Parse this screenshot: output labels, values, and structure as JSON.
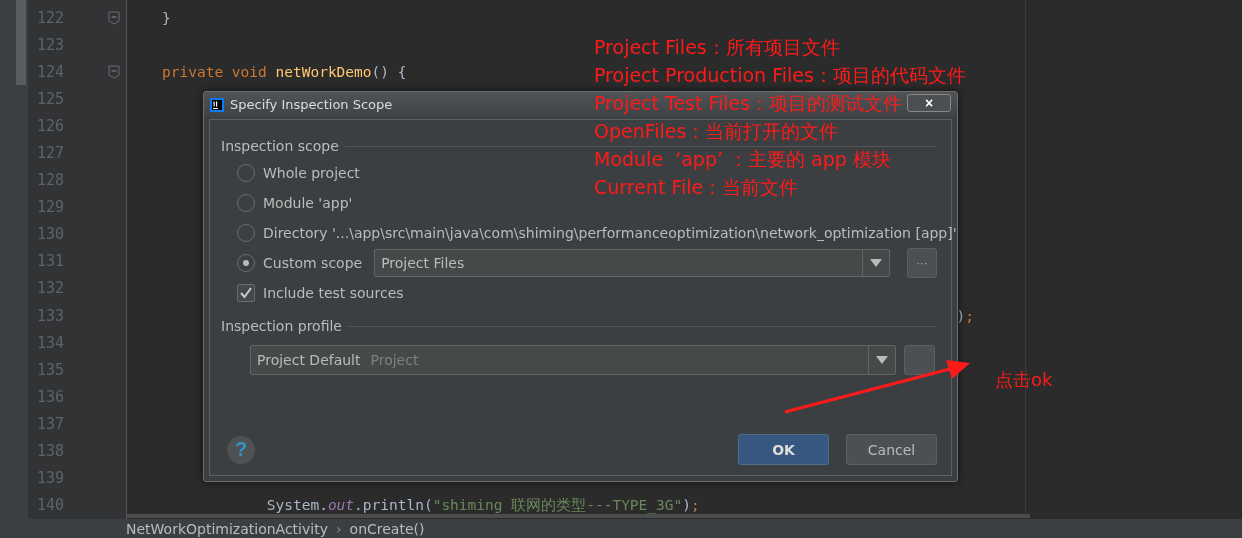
{
  "editor": {
    "lines": [
      {
        "number": "122",
        "fold": true,
        "tokens": [
          {
            "kind": "plain",
            "text": "}"
          }
        ]
      },
      {
        "number": "123",
        "fold": false
      },
      {
        "number": "124",
        "fold": true,
        "tokens": [
          {
            "kind": "keyword",
            "text": "private void "
          },
          {
            "kind": "method",
            "text": "netWorkDemo"
          },
          {
            "kind": "plain",
            "text": "() {"
          }
        ]
      },
      {
        "number": "125",
        "fold": false
      },
      {
        "number": "126",
        "fold": false
      },
      {
        "number": "127",
        "fold": false
      },
      {
        "number": "128",
        "fold": false
      },
      {
        "number": "129",
        "fold": false
      },
      {
        "number": "130",
        "fold": false
      },
      {
        "number": "131",
        "fold": false
      },
      {
        "number": "132",
        "fold": false
      },
      {
        "number": "133",
        "fold": false,
        "tokens": [
          {
            "kind": "plain",
            "text": "                                                                                           )"
          },
          {
            "kind": "keyword",
            "text": ";"
          }
        ]
      },
      {
        "number": "134",
        "fold": false
      },
      {
        "number": "135",
        "fold": false
      },
      {
        "number": "136",
        "fold": false
      },
      {
        "number": "137",
        "fold": false
      },
      {
        "number": "138",
        "fold": false
      },
      {
        "number": "139",
        "fold": false
      },
      {
        "number": "140",
        "fold": false,
        "tokens": [
          {
            "kind": "plain",
            "text": "            System."
          },
          {
            "kind": "field",
            "text": "out"
          },
          {
            "kind": "plain",
            "text": ".println("
          },
          {
            "kind": "string",
            "text": "\"shiming 联网的类型---TYPE_3G\""
          },
          {
            "kind": "plain",
            "text": ")"
          },
          {
            "kind": "keyword",
            "text": ";"
          }
        ]
      }
    ]
  },
  "breadcrumb": [
    "NetWorkOptimizationActivity",
    "›",
    "onCreate()"
  ],
  "dialog": {
    "title": "Specify Inspection Scope",
    "close": "×",
    "scope_section": "Inspection scope",
    "options": [
      {
        "kind": "radio",
        "label": "Whole project",
        "selected": false
      },
      {
        "kind": "radio",
        "label": "Module 'app'",
        "selected": false
      },
      {
        "kind": "radio",
        "label": "Directory '...\\app\\src\\main\\java\\com\\shiming\\performanceoptimization\\network_optimization [app]'",
        "selected": false
      },
      {
        "kind": "scope",
        "label": "Custom scope",
        "selected": true,
        "value": "Project Files",
        "more": "···"
      }
    ],
    "include_test": {
      "label": "Include test sources",
      "checked": true
    },
    "profile_section": "Inspection profile",
    "profile": {
      "value": "Project Default",
      "hint": "Project"
    },
    "help": "?",
    "buttons": [
      {
        "label": "OK",
        "default": true
      },
      {
        "label": "Cancel",
        "default": false
      }
    ]
  },
  "annotations": [
    "Project Files：所有项目文件",
    "Project Production Files：项目的代码文件",
    "Project Test Files：项目的测试文件",
    "OpenFiles：当前打开的文件",
    "Module  ‘app’ ：主要的 app 模块",
    "Current File：当前文件"
  ],
  "callout": "点击ok"
}
